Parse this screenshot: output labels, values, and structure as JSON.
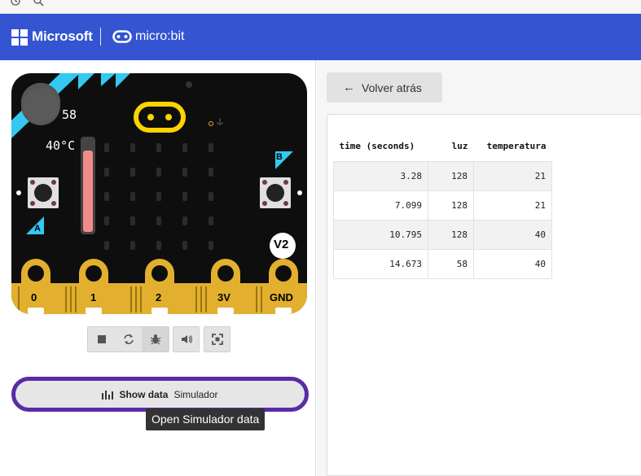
{
  "header": {
    "brand": "Microsoft",
    "product": "micro:bit"
  },
  "simulator": {
    "light_level": "58",
    "temperature": "40°C",
    "button_a": "A",
    "button_b": "B",
    "version": "V2",
    "pins": [
      "0",
      "1",
      "2",
      "3V",
      "GND"
    ],
    "controls": [
      "stop-icon",
      "restart-icon",
      "debug-icon",
      "sound-icon",
      "fullscreen-icon"
    ]
  },
  "show_data": {
    "bold_label": "Show data",
    "label": "Simulador",
    "tooltip": "Open Simulador data"
  },
  "data_view": {
    "back_label": "Volver atrás",
    "table": {
      "columns": [
        "time (seconds)",
        "luz",
        "temperatura"
      ],
      "rows": [
        [
          "3.28",
          "128",
          "21"
        ],
        [
          "7.099",
          "128",
          "21"
        ],
        [
          "10.795",
          "128",
          "40"
        ],
        [
          "14.673",
          "58",
          "40"
        ]
      ]
    }
  },
  "colors": {
    "header_bg": "#3454d1",
    "board_bg": "#0e0e0e",
    "accent_cyan": "#33c9f0",
    "gold": "#e2b02e",
    "logo_yellow": "#ffd200",
    "thermometer": "#f38b8b",
    "show_data_border": "#5b2aa8"
  }
}
